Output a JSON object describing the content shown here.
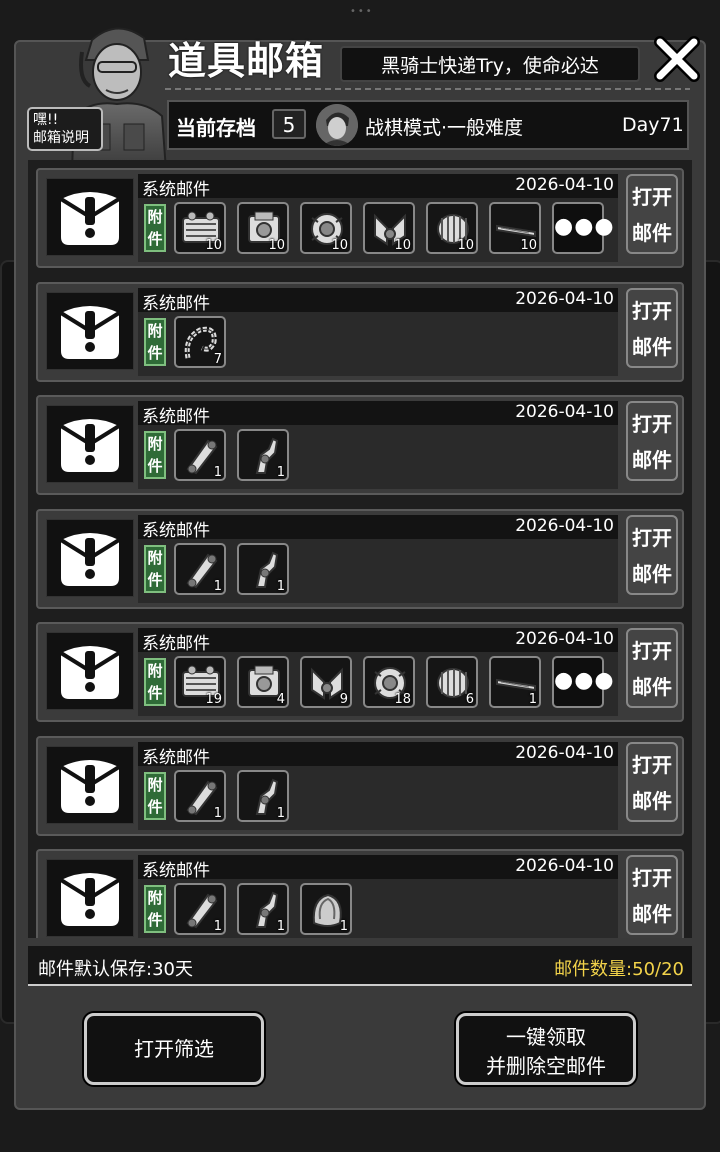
{
  "header": {
    "title": "道具邮箱",
    "slogan": "黑骑士快递Try，使命必达",
    "help_label": "嘿!!\n邮箱说明"
  },
  "save": {
    "label": "当前存档",
    "slot": "5",
    "mode": "战棋模式·一般难度",
    "day": "Day71"
  },
  "mails": [
    {
      "sender": "系统邮件",
      "date": "2026-04-10",
      "attach": "附件",
      "open": "打开邮件",
      "items": [
        {
          "icon": "armor-crate-icon",
          "count": "10"
        },
        {
          "icon": "engine-icon",
          "count": "10"
        },
        {
          "icon": "motor-assembly-icon",
          "count": "10"
        },
        {
          "icon": "v-engine-icon",
          "count": "10"
        },
        {
          "icon": "barrel-drum-icon",
          "count": "10"
        },
        {
          "icon": "blade-bar-icon",
          "count": "10"
        }
      ],
      "more": true
    },
    {
      "sender": "系统邮件",
      "date": "2026-04-10",
      "attach": "附件",
      "open": "打开邮件",
      "items": [
        {
          "icon": "chain-whip-icon",
          "count": "7"
        }
      ],
      "more": false
    },
    {
      "sender": "系统邮件",
      "date": "2026-04-10",
      "attach": "附件",
      "open": "打开邮件",
      "items": [
        {
          "icon": "track-part-icon",
          "count": "1"
        },
        {
          "icon": "mech-arm-icon",
          "count": "1"
        }
      ],
      "more": false
    },
    {
      "sender": "系统邮件",
      "date": "2026-04-10",
      "attach": "附件",
      "open": "打开邮件",
      "items": [
        {
          "icon": "track-part-icon",
          "count": "1"
        },
        {
          "icon": "mech-arm-icon",
          "count": "1"
        }
      ],
      "more": false
    },
    {
      "sender": "系统邮件",
      "date": "2026-04-10",
      "attach": "附件",
      "open": "打开邮件",
      "items": [
        {
          "icon": "armor-crate-icon",
          "count": "19"
        },
        {
          "icon": "engine-icon",
          "count": "4"
        },
        {
          "icon": "v-engine-icon",
          "count": "9"
        },
        {
          "icon": "motor-assembly-icon",
          "count": "18"
        },
        {
          "icon": "barrel-drum-icon",
          "count": "6"
        },
        {
          "icon": "blade-bar-icon",
          "count": "1"
        }
      ],
      "more": true
    },
    {
      "sender": "系统邮件",
      "date": "2026-04-10",
      "attach": "附件",
      "open": "打开邮件",
      "items": [
        {
          "icon": "track-part-icon",
          "count": "1"
        },
        {
          "icon": "mech-arm-icon",
          "count": "1"
        }
      ],
      "more": false
    },
    {
      "sender": "系统邮件",
      "date": "2026-04-10",
      "attach": "附件",
      "open": "打开邮件",
      "items": [
        {
          "icon": "track-part-icon",
          "count": "1"
        },
        {
          "icon": "mech-arm-icon",
          "count": "1"
        },
        {
          "icon": "armor-shell-icon",
          "count": "1"
        }
      ],
      "more": false
    }
  ],
  "footer": {
    "retention": "邮件默认保存:30天",
    "count": "邮件数量:50/20"
  },
  "buttons": {
    "filter": "打开筛选",
    "claim_line1": "一键领取",
    "claim_line2": "并删除空邮件"
  },
  "colors": {
    "accent_yellow": "#f2d34a",
    "attach_green": "#2f6b37"
  }
}
